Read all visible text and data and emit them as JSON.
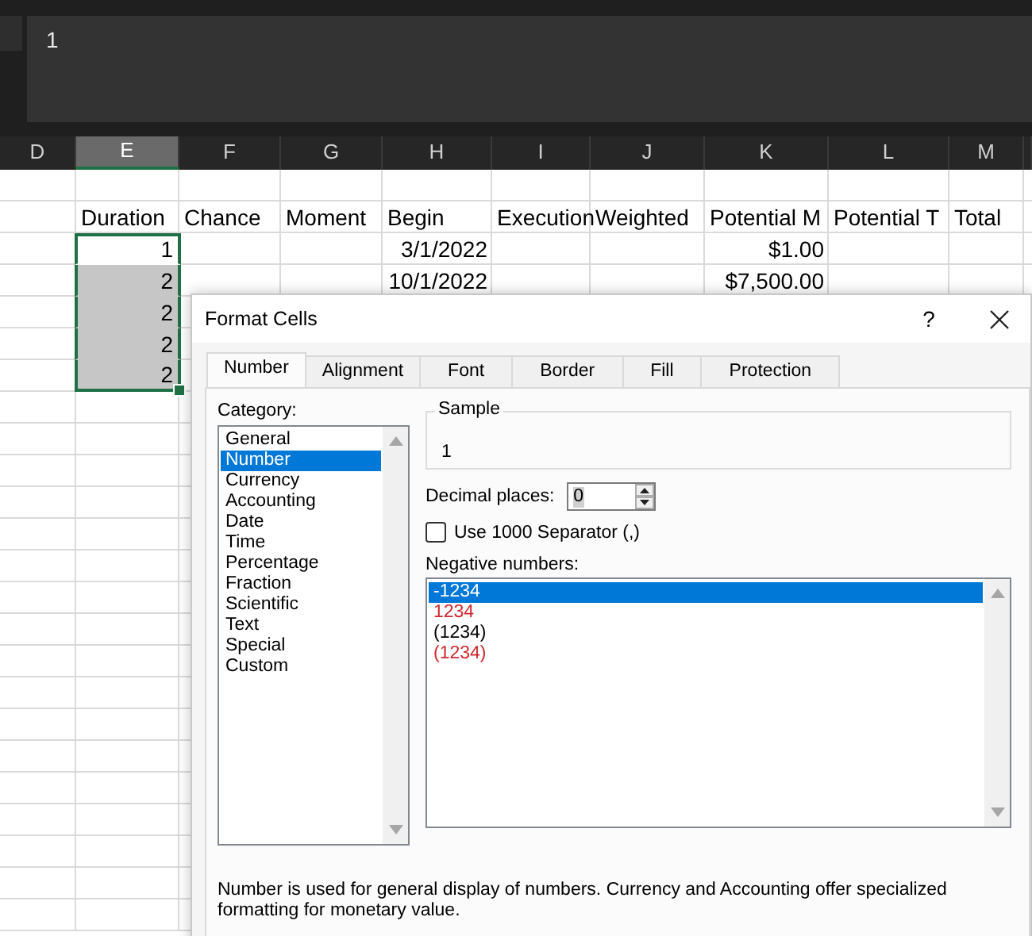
{
  "formula_bar": {
    "value": "1"
  },
  "sheet": {
    "columns": [
      {
        "label": "D",
        "selected": false
      },
      {
        "label": "E",
        "selected": true
      },
      {
        "label": "F",
        "selected": false
      },
      {
        "label": "G",
        "selected": false
      },
      {
        "label": "H",
        "selected": false
      },
      {
        "label": "I",
        "selected": false
      },
      {
        "label": "J",
        "selected": false
      },
      {
        "label": "K",
        "selected": false
      },
      {
        "label": "L",
        "selected": false
      },
      {
        "label": "M",
        "selected": false
      }
    ],
    "rows": [
      {
        "kind": "header",
        "cells": {
          "E": "Duration",
          "F": "Chance",
          "G": "Moment",
          "H": "Begin",
          "I": "Execution",
          "J": "Weighted",
          "K": "Potential M",
          "L": "Potential T",
          "M": "Total"
        }
      },
      {
        "kind": "data",
        "in_selection": true,
        "cells": {
          "E": "1",
          "H": "3/1/2022",
          "K": "$1.00"
        }
      },
      {
        "kind": "data",
        "in_selection": true,
        "cells": {
          "E": "2",
          "H": "10/1/2022",
          "K": "$7,500.00"
        }
      },
      {
        "kind": "data",
        "in_selection": true,
        "cells": {
          "E": "2"
        }
      },
      {
        "kind": "data",
        "in_selection": true,
        "cells": {
          "E": "2"
        }
      },
      {
        "kind": "data",
        "in_selection": true,
        "cells": {
          "E": "2"
        }
      }
    ]
  },
  "dialog": {
    "title": "Format Cells",
    "help": "?",
    "tabs": [
      {
        "label": "Number",
        "selected": true
      },
      {
        "label": "Alignment",
        "selected": false
      },
      {
        "label": "Font",
        "selected": false
      },
      {
        "label": "Border",
        "selected": false
      },
      {
        "label": "Fill",
        "selected": false
      },
      {
        "label": "Protection",
        "selected": false
      }
    ],
    "category": {
      "label": "Category:",
      "items": [
        {
          "label": "General",
          "selected": false
        },
        {
          "label": "Number",
          "selected": true
        },
        {
          "label": "Currency",
          "selected": false
        },
        {
          "label": "Accounting",
          "selected": false
        },
        {
          "label": "Date",
          "selected": false
        },
        {
          "label": "Time",
          "selected": false
        },
        {
          "label": "Percentage",
          "selected": false
        },
        {
          "label": "Fraction",
          "selected": false
        },
        {
          "label": "Scientific",
          "selected": false
        },
        {
          "label": "Text",
          "selected": false
        },
        {
          "label": "Special",
          "selected": false
        },
        {
          "label": "Custom",
          "selected": false
        }
      ]
    },
    "sample": {
      "legend": "Sample",
      "value": "1"
    },
    "decimal_places": {
      "label": "Decimal places:",
      "value": "0"
    },
    "separator": {
      "label": "Use 1000 Separator (,)",
      "checked": false
    },
    "negative_numbers": {
      "label": "Negative numbers:",
      "items": [
        {
          "label": "-1234",
          "selected": true
        },
        {
          "label": "1234",
          "selected": false,
          "color": "#d0272e"
        },
        {
          "label": "(1234)",
          "selected": false,
          "color": "#000000"
        },
        {
          "label": "(1234)",
          "selected": false,
          "color": "#d0272e"
        }
      ]
    },
    "description": "Number is used for general display of numbers.  Currency and Accounting offer specialized formatting for monetary value."
  }
}
